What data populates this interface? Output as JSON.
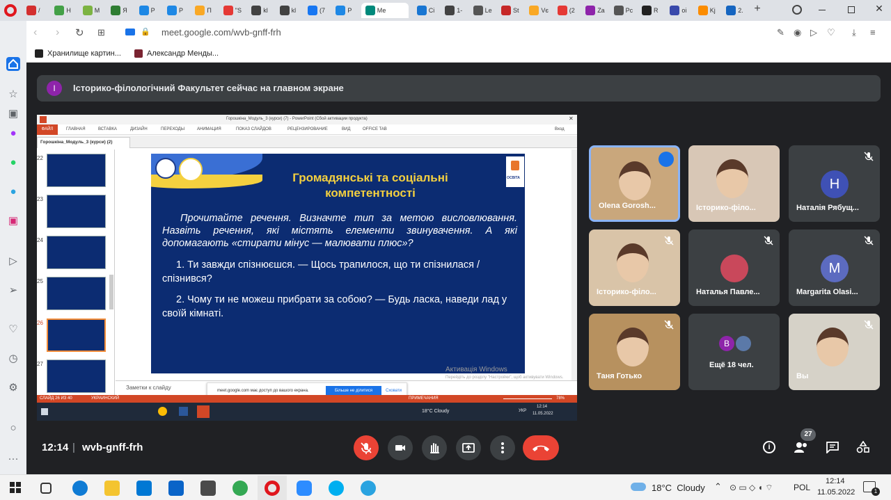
{
  "browser": {
    "tabs": [
      {
        "label": "/",
        "color": "#d32f2f"
      },
      {
        "label": "Н",
        "color": "#43a047"
      },
      {
        "label": "М",
        "color": "#7cb342"
      },
      {
        "label": "Я",
        "color": "#2e7d32"
      },
      {
        "label": "Р",
        "color": "#1e88e5"
      },
      {
        "label": "Р",
        "color": "#1e88e5"
      },
      {
        "label": "П",
        "color": "#f9a825"
      },
      {
        "label": "\"S",
        "color": "#e53935"
      },
      {
        "label": "kl",
        "color": "#424242"
      },
      {
        "label": "kl",
        "color": "#424242"
      },
      {
        "label": "(7",
        "color": "#1877f2"
      },
      {
        "label": "Р",
        "color": "#1e88e5"
      },
      {
        "label": "Ме",
        "color": "#00897b"
      },
      {
        "label": "Сі",
        "color": "#1976d2"
      },
      {
        "label": "1-",
        "color": "#424242"
      },
      {
        "label": "Lе",
        "color": "#555"
      },
      {
        "label": "St",
        "color": "#c62828"
      },
      {
        "label": "Vє",
        "color": "#f9a825"
      },
      {
        "label": "(2",
        "color": "#e53935"
      },
      {
        "label": "Zа",
        "color": "#8e24aa"
      },
      {
        "label": "Рс",
        "color": "#555"
      },
      {
        "label": "R",
        "color": "#212121"
      },
      {
        "label": "оі",
        "color": "#3949ab"
      },
      {
        "label": "Kj",
        "color": "#fb8c00"
      },
      {
        "label": "2.",
        "color": "#1565c0"
      }
    ],
    "url": "meet.google.com/wvb-gnff-frh",
    "bookmarks": [
      "Хранилище картин...",
      "Александр Менды..."
    ]
  },
  "meet": {
    "banner": {
      "avatar_letter": "І",
      "text": "Історико-філологічний Факультет сейчас на главном экране"
    },
    "participants": [
      {
        "name": "Olena Gorosh...",
        "type": "video",
        "speaking": true
      },
      {
        "name": "Історико-філо...",
        "type": "video",
        "speaking": false
      },
      {
        "name": "Наталія Рябущ...",
        "type": "avatar",
        "letter": "Н",
        "avatar_color": "#3f51b5",
        "muted": true
      },
      {
        "name": "Історико-філо...",
        "type": "video",
        "muted": true
      },
      {
        "name": "Наталья Павле...",
        "type": "photo",
        "muted": true
      },
      {
        "name": "Margarita Olasi...",
        "type": "avatar",
        "letter": "М",
        "avatar_color": "#5c6bc0",
        "muted": true
      },
      {
        "name": "Таня Готько",
        "type": "video",
        "muted": true
      },
      {
        "name": "Ещё 18 чел.",
        "type": "more",
        "letter": "В"
      },
      {
        "name": "Вы",
        "type": "video",
        "muted": true
      }
    ],
    "time": "12:14",
    "meeting_code": "wvb-gnff-frh",
    "participants_count": "27"
  },
  "powerpoint": {
    "title": "Горошкіна_Модуль_3 (курси) (7) - PowerPoint (Сбой активации продукта)",
    "ribbon_tabs": [
      "ФАЙЛ",
      "ГЛАВНАЯ",
      "ВСТАВКА",
      "ДИЗАЙН",
      "ПЕРЕХОДЫ",
      "АНИМАЦИЯ",
      "ПОКАЗ СЛАЙДОВ",
      "РЕЦЕНЗИРОВАНИЕ",
      "ВИД",
      "OFFICE TAB"
    ],
    "login": "Вход",
    "doc_tab": "Горошкіна_Модуль_3 (курси) (2)",
    "slide_numbers": [
      "22",
      "23",
      "24",
      "25",
      "26",
      "27"
    ],
    "slide": {
      "title": "Громадянські та соціальні компетентності",
      "logo_text": "ОСВІТА",
      "instruction": "Прочитайте речення. Визначте тип за метою висловлювання. Назвіть речення, які містять елементи звинувачення. А які допомагають «стирати мінус — малювати плюс»?",
      "item1": "1. Ти завжди спізнюєшся. — Щось трапилося, що ти спізнилася / спізнився?",
      "item2": "2. Чому ти не можеш прибрати за собою? — Будь ласка, наведи лад у своїй кімнаті."
    },
    "notes_label": "Заметки к слайду",
    "activation": "Активація Windows",
    "activation_sub": "Перейдіть до розділу \"Настройки\", щоб активувати Windows.",
    "share_notice": "meet.google.com має доступ до вашого екрана.",
    "share_stop": "Більше не ділитися",
    "share_hide": "Сховати",
    "status_left": "СЛАЙД 26 ИЗ 40",
    "status_lang": "УКРАИНСКИЙ",
    "status_notes": "ПРИМЕЧАНИЯ",
    "zoom": "78%",
    "inner_weather": "18°C Cloudy",
    "inner_lang": "УКР",
    "inner_time": "12:14",
    "inner_date": "11.05.2022"
  },
  "taskbar": {
    "weather": "18°C  Cloudy",
    "lang": "POL",
    "time": "12:14",
    "date": "11.05.2022",
    "notifications": "1"
  }
}
